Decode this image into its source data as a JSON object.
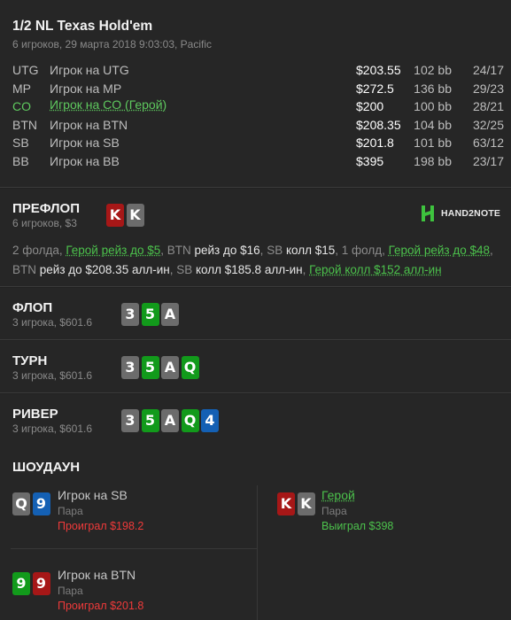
{
  "header": {
    "title": "1/2 NL Texas Hold'em",
    "subtitle": "6 игроков, 29 марта 2018 9:03:03, Pacific"
  },
  "players": [
    {
      "pos": "UTG",
      "name": "Игрок на UTG",
      "stack": "$203.55",
      "bb": "102 bb",
      "stat": "24/17",
      "hero": false
    },
    {
      "pos": "MP",
      "name": "Игрок на MP",
      "stack": "$272.5",
      "bb": "136 bb",
      "stat": "29/23",
      "hero": false
    },
    {
      "pos": "CO",
      "name": "Игрок на CO (Герой)",
      "stack": "$200",
      "bb": "100 bb",
      "stat": "28/21",
      "hero": true
    },
    {
      "pos": "BTN",
      "name": "Игрок на BTN",
      "stack": "$208.35",
      "bb": "104 bb",
      "stat": "32/25",
      "hero": false
    },
    {
      "pos": "SB",
      "name": "Игрок на SB",
      "stack": "$201.8",
      "bb": "101 bb",
      "stat": "63/12",
      "hero": false
    },
    {
      "pos": "BB",
      "name": "Игрок на BB",
      "stack": "$395",
      "bb": "198 bb",
      "stat": "23/17",
      "hero": false
    }
  ],
  "preflop": {
    "title": "ПРЕФЛОП",
    "sub": "6 игроков, $3",
    "hero_cards": [
      {
        "rank": "K",
        "suit": "red"
      },
      {
        "rank": "K",
        "suit": "gray"
      }
    ],
    "logo_text": "HAND2NOTE",
    "actions": [
      {
        "text": "2 фолда, ",
        "style": "muted"
      },
      {
        "text": "Герой рейз до $5",
        "style": "hero"
      },
      {
        "text": ", ",
        "style": "muted"
      },
      {
        "text": "BTN ",
        "style": "muted"
      },
      {
        "text": "рейз до $16",
        "style": "strong"
      },
      {
        "text": ", ",
        "style": "muted"
      },
      {
        "text": "SB ",
        "style": "muted"
      },
      {
        "text": "колл $15",
        "style": "strong"
      },
      {
        "text": ", 1 фолд, ",
        "style": "muted"
      },
      {
        "text": "Герой рейз до $48",
        "style": "hero"
      },
      {
        "text": ", ",
        "style": "muted"
      },
      {
        "text": "BTN ",
        "style": "muted"
      },
      {
        "text": "рейз до $208.35 алл-ин",
        "style": "strong"
      },
      {
        "text": ", ",
        "style": "muted"
      },
      {
        "text": "SB ",
        "style": "muted"
      },
      {
        "text": "колл $185.8 алл-ин",
        "style": "strong"
      },
      {
        "text": ", ",
        "style": "muted"
      },
      {
        "text": "Герой колл $152 алл-ин",
        "style": "hero"
      }
    ]
  },
  "flop": {
    "title": "ФЛОП",
    "sub": "3 игрока, $601.6",
    "cards": [
      {
        "rank": "3",
        "suit": "gray"
      },
      {
        "rank": "5",
        "suit": "green"
      },
      {
        "rank": "A",
        "suit": "gray"
      }
    ]
  },
  "turn": {
    "title": "ТУРН",
    "sub": "3 игрока, $601.6",
    "cards": [
      {
        "rank": "3",
        "suit": "gray"
      },
      {
        "rank": "5",
        "suit": "green"
      },
      {
        "rank": "A",
        "suit": "gray"
      },
      {
        "rank": "Q",
        "suit": "green"
      }
    ]
  },
  "river": {
    "title": "РИВЕР",
    "sub": "3 игрока, $601.6",
    "cards": [
      {
        "rank": "3",
        "suit": "gray"
      },
      {
        "rank": "5",
        "suit": "green"
      },
      {
        "rank": "A",
        "suit": "gray"
      },
      {
        "rank": "Q",
        "suit": "green"
      },
      {
        "rank": "4",
        "suit": "blue"
      }
    ]
  },
  "showdown": {
    "title": "ШОУДАУН",
    "sb": {
      "name": "Игрок на SB",
      "hand": "Пара",
      "result": "Проиграл $198.2",
      "cards": [
        {
          "rank": "Q",
          "suit": "gray"
        },
        {
          "rank": "9",
          "suit": "blue"
        }
      ]
    },
    "btn": {
      "name": "Игрок на BTN",
      "hand": "Пара",
      "result": "Проиграл $201.8",
      "cards": [
        {
          "rank": "9",
          "suit": "green"
        },
        {
          "rank": "9",
          "suit": "red"
        }
      ]
    },
    "hero": {
      "name": "Герой",
      "hand": "Пара",
      "result": "Выиграл $398",
      "cards": [
        {
          "rank": "K",
          "suit": "red"
        },
        {
          "rank": "K",
          "suit": "gray"
        }
      ]
    }
  },
  "colors": {
    "background": "#222222",
    "hero_green": "#4cc24c",
    "lose_red": "#f03a3a",
    "card_red": "#a61717",
    "card_green": "#129a1b",
    "card_blue": "#1460b4",
    "card_gray": "#6c6c6c"
  }
}
